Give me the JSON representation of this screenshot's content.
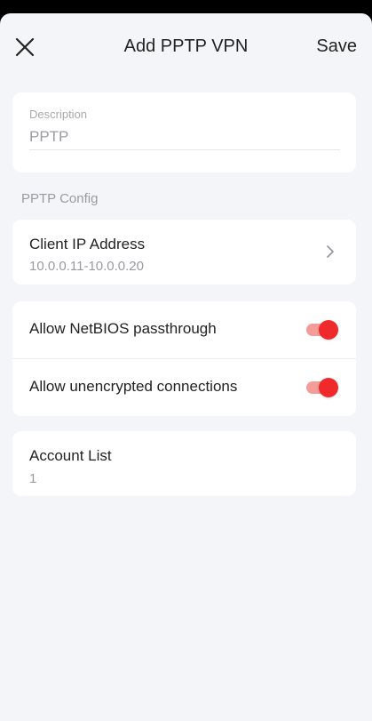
{
  "header": {
    "title": "Add PPTP VPN",
    "save_label": "Save",
    "close_icon": "close-icon"
  },
  "description": {
    "label": "Description",
    "placeholder": "PPTP",
    "value": ""
  },
  "pptp_config": {
    "section_label": "PPTP Config",
    "client_ip": {
      "label": "Client IP Address",
      "value": "10.0.0.11-10.0.0.20",
      "icon": "chevron-right-icon"
    },
    "toggles": [
      {
        "label": "Allow NetBIOS passthrough",
        "enabled": true
      },
      {
        "label": "Allow unencrypted connections",
        "enabled": true
      }
    ]
  },
  "accounts": {
    "label": "Account List",
    "count": "1"
  },
  "colors": {
    "accent": "#f02a2a",
    "accent_track": "#f39c98",
    "background": "#f4f5f9"
  }
}
